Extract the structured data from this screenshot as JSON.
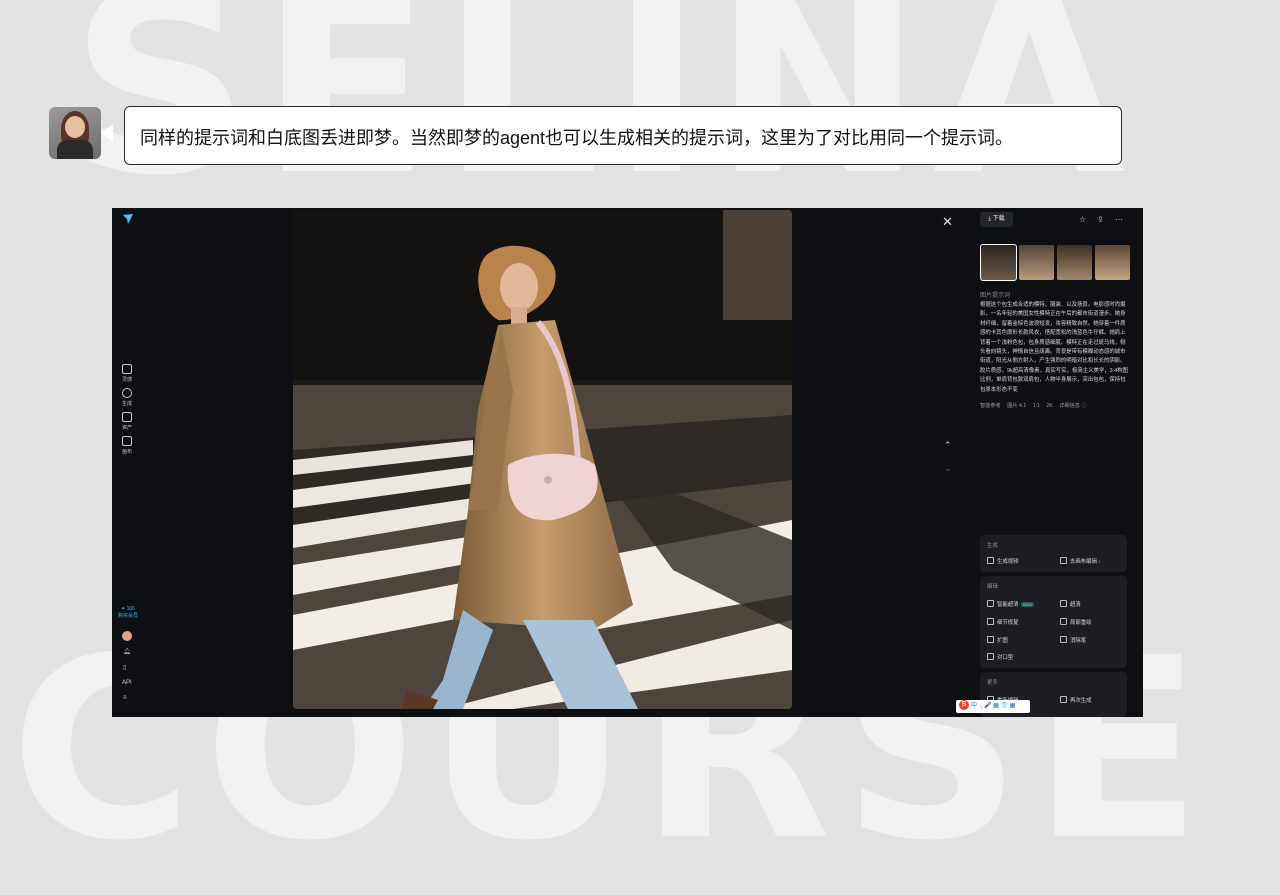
{
  "background": {
    "word_top": "SELINA",
    "word_bottom": "COURSE"
  },
  "bubble": {
    "text": "同样的提示词和白底图丢进即梦。当然即梦的agent也可以生成相关的提示词，这里为了对比用同一个提示词。"
  },
  "app": {
    "left_nav": [
      {
        "label": "灵感",
        "icon": "home-icon"
      },
      {
        "label": "生成",
        "icon": "sparkle-icon"
      },
      {
        "label": "资产",
        "icon": "folder-icon"
      },
      {
        "label": "画布",
        "icon": "grid-icon"
      }
    ],
    "credits": {
      "value": "✦ 106",
      "label": "购买会员"
    },
    "bottom": {
      "api_label": "API"
    },
    "top_right": {
      "download_label": "下载"
    },
    "prompt_label": "图片提示词",
    "prompt_text": "根据这个包生成合适的模特、服装、以及场景。电影感时尚摄影，一名年轻的美国女性模特正在午后的都市街道漫步。她身材纤细，留着金棕色波浪短发，妆容精致自然。她穿着一件质感的卡其色廓形长款风衣，搭配宽松的浅蓝色牛仔裤。她肩上背着一个浅粉色包，包身质感细腻。模特正在走过斑马线，侧头看向镜头，神情自信且疏离。背景是带有模糊动态感的城市街道，阳光从侧方射入，产生强烈的明暗对比和长长的阴影。胶片质感，9k超高清像素，真实写实，极简主义美学，3:4构图比例，单肩背包款双肩包，人物半身展示，突出包包，保持包包原本形态不变",
    "meta": {
      "ref": "智能参考",
      "model": "图片 4.1",
      "ratio": "1:1",
      "res": "2K",
      "detail": "详细信息 ⓘ"
    },
    "generate": {
      "title": "生成",
      "video": "生成视频",
      "canvas": "去画布编辑 ›"
    },
    "edit": {
      "title": "编辑",
      "smart_upscale": "智能超清",
      "new_badge": "NEW",
      "upscale": "超清",
      "detail_fix": "细节修复",
      "partial_redraw": "局部重绘",
      "expand": "扩图",
      "eraser": "消除笔",
      "mouth_sync": "对口型"
    },
    "more": {
      "title": "更多",
      "re_edit": "重新编辑",
      "regenerate": "再次生成"
    },
    "ime": {
      "logo": "S",
      "text": "中 ·, 🎤 ▦ 👕 ▦"
    }
  }
}
